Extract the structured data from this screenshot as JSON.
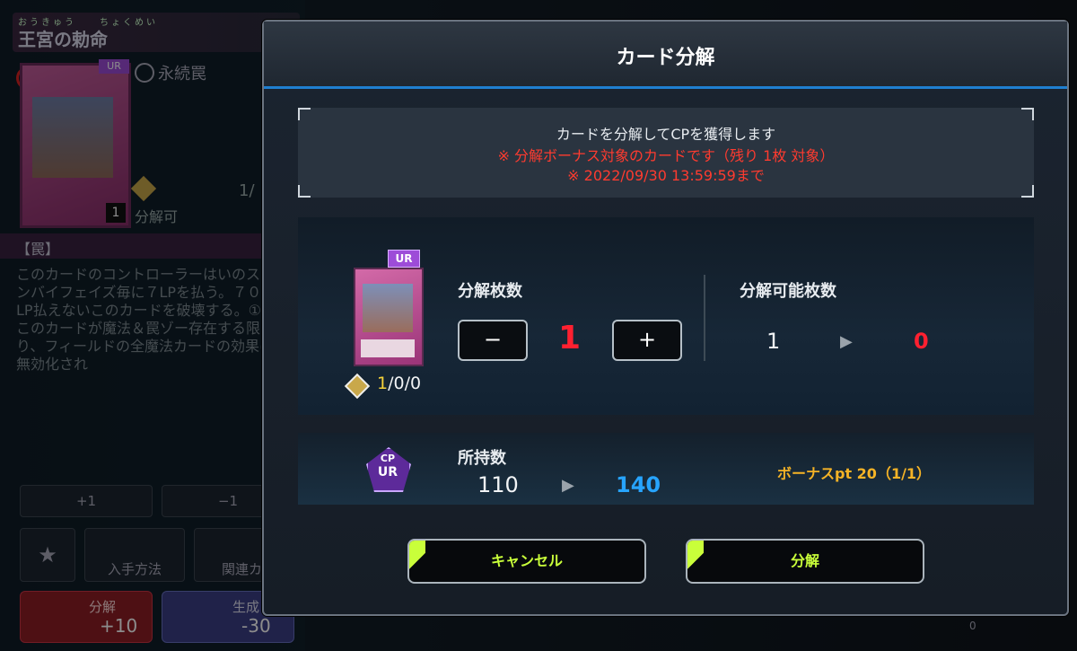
{
  "background": {
    "card_ruby": "おうきゅう　　ちょくめい",
    "card_name": "王宮の勅命",
    "rarity": "UR",
    "card_type": "永続罠",
    "dismantle_status": "分解可",
    "count_badge": "1",
    "owned_partial": "1/",
    "section_label": "【罠】",
    "description": "このカードのコントローラーはいのスタンバイフェイズ毎に７LPを払う。７００LP払えないこのカードを破壊する。①：このカードが魔法＆罠ゾー存在する限り、フィールドの全魔法カードの効果は無効化され",
    "btn_plus1": "+1",
    "btn_minus1": "−1",
    "btn_acquire": "入手方法",
    "btn_related": "関連カー",
    "btn_dismantle": "分解",
    "btn_dismantle_value": "+10",
    "btn_generate": "生成",
    "btn_generate_value": "-30",
    "corner_zero": "0"
  },
  "modal": {
    "title": "カード分解",
    "info_line1": "カードを分解してCPを獲得します",
    "info_line2": "※ 分解ボーナス対象のカードです（残り 1枚 対象）",
    "info_line3": "※ 2022/09/30 13:59:59まで",
    "card_rarity": "UR",
    "owned_prefix": "1",
    "owned_suffix": "/0/0",
    "dismantle_count_label": "分解枚数",
    "minus_label": "−",
    "plus_label": "+",
    "dismantle_count": "1",
    "available_label": "分解可能枚数",
    "available_before": "1",
    "available_after": "0",
    "cp_badge_top": "CP",
    "cp_badge_bottom": "UR",
    "owned_label": "所持数",
    "owned_before": "110",
    "owned_after": "140",
    "bonus_text": "ボーナスpt 20（1/1）",
    "cancel_label": "キャンセル",
    "confirm_label": "分解"
  },
  "colors": {
    "accent_blue": "#1f7fd0",
    "warning_red": "#ff3b2f",
    "button_green": "#c9ff3a",
    "bonus_orange": "#f5b326",
    "gain_blue": "#27a4ff",
    "rarity_purple": "#9d4cd8"
  }
}
